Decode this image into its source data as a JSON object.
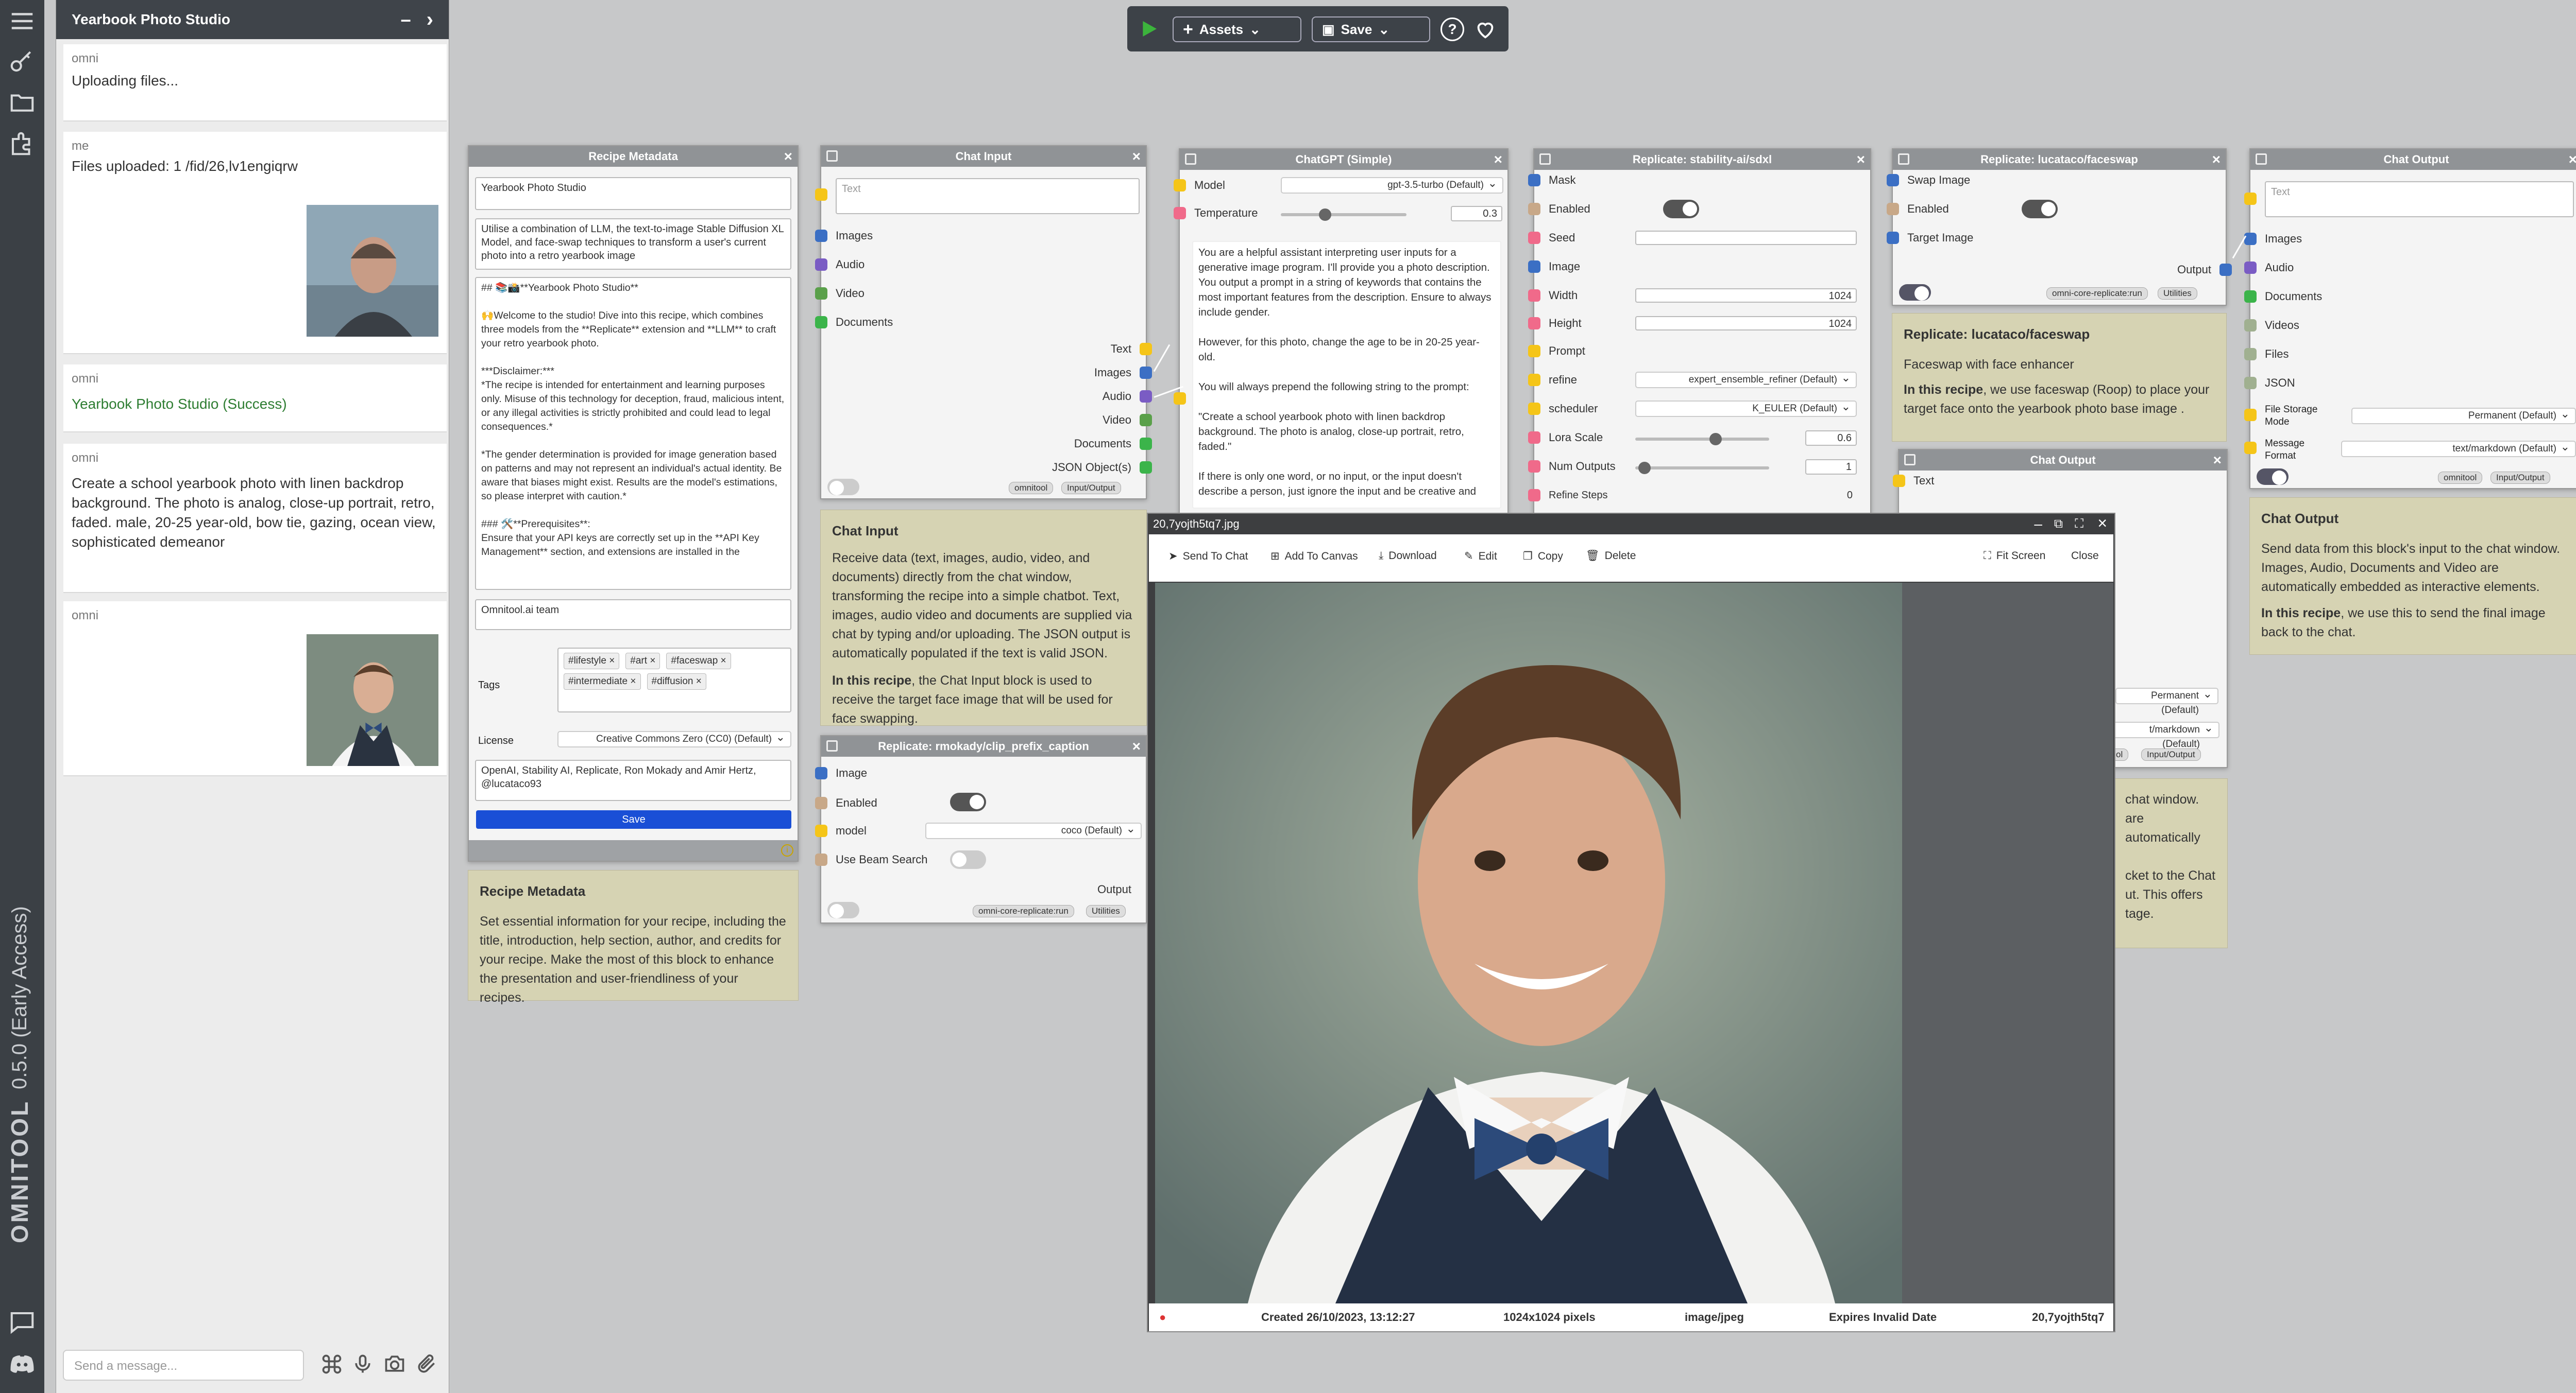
{
  "topbar": {
    "assets_label": "Assets",
    "save_label": "Save"
  },
  "chat": {
    "title": "Yearbook Photo Studio",
    "input_placeholder": "Send a message...",
    "messages": [
      {
        "sender": "omni",
        "text": "Uploading files..."
      },
      {
        "sender": "me",
        "text": "Files uploaded: 1 /fid/26,lv1engiqrw"
      },
      {
        "sender": "omni",
        "text": "Yearbook Photo Studio  (Success)"
      },
      {
        "sender": "omni",
        "text": "Create a school yearbook photo with linen backdrop background. The photo is analog, close-up portrait, retro, faded. male, 20-25 year-old, bow tie, gazing, ocean view, sophisticated demeanor"
      },
      {
        "sender": "omni",
        "text": ""
      }
    ]
  },
  "brand": {
    "name": "OMNITOOL",
    "version": "0.5.0 (Early Access)"
  },
  "recipe": {
    "title": "Recipe Metadata",
    "name": "Yearbook Photo Studio",
    "intro": "Utilise a combination of LLM, the text-to-image Stable Diffusion XL Model, and face-swap techniques to transform a user's current photo into a retro yearbook image",
    "help": "## 📚📸**Yearbook Photo Studio**\n\n🙌Welcome to the studio! Dive into this recipe, which combines three models from the **Replicate** extension and **LLM** to craft your retro yearbook photo.\n\n***Disclaimer:***\n*The recipe is intended for entertainment and learning purposes only. Misuse of this technology for deception, fraud, malicious intent, or any illegal activities is strictly prohibited and could lead to legal consequences.*\n\n*The gender determination is provided for image generation based on patterns and may not represent an individual's actual identity. Be aware that biases might exist. Results are the model's estimations, so please interpret with caution.*\n\n### 🛠️**Prerequisites**:\nEnsure that your API keys are correctly set up in the **API Key Management** section, and extensions are installed in the",
    "author": "Omnitool.ai team",
    "tags_label": "Tags",
    "tags": [
      "#lifestyle",
      "#art",
      "#faceswap",
      "#intermediate",
      "#diffusion"
    ],
    "license_label": "License",
    "license": "Creative Commons Zero (CC0) (Default)",
    "credits": "OpenAI, Stability AI, Replicate, Ron Mokady and Amir Hertz, @lucataco93",
    "save": "Save"
  },
  "recipe_note": {
    "title": "Recipe Metadata",
    "text": "Set essential information for your recipe, including the title, introduction, help section, author, and credits for your recipe. Make the most of this block to enhance the presentation and user-friendliness of your recipes."
  },
  "chat_input": {
    "title": "Chat Input",
    "placeholder": "Text",
    "inputs": [
      "Images",
      "Audio",
      "Video",
      "Documents"
    ],
    "outputs": [
      "Text",
      "Images",
      "Audio",
      "Video",
      "Documents",
      "JSON Object(s)"
    ],
    "badges": [
      "omnitool",
      "Input/Output"
    ]
  },
  "chat_input_note": {
    "title": "Chat Input",
    "text": "Receive data (text, images, audio, video, and documents) directly from the chat window, transforming the recipe into a simple chatbot. Text, images, audio video and documents are supplied via chat by typing and/or uploading. The JSON output is automatically populated if the text is valid JSON.",
    "bold": "In this recipe",
    "text2": ", the Chat Input block is used to receive the target face image that will be used for face swapping."
  },
  "clip": {
    "title": "Replicate: rmokady/clip_prefix_caption",
    "image": "Image",
    "enabled": "Enabled",
    "model": "model",
    "model_value": "coco (Default)",
    "beam": "Use Beam Search",
    "output": "Output",
    "badges": [
      "omni-core-replicate:run",
      "Utilities"
    ]
  },
  "gpt": {
    "title": "ChatGPT (Simple)",
    "model_label": "Model",
    "model_value": "gpt-3.5-turbo (Default)",
    "temp_label": "Temperature",
    "temp_value": "0.3",
    "prompt": "You are a helpful assistant interpreting user inputs for a generative image program. I'll provide you a photo description. You output a prompt in a string of keywords that contains the most important features from the description. Ensure to always include gender.\n\nHowever, for this photo, change the age to be in 20-25 year-old.\n\nYou will always prepend the following string to the prompt:\n\n\"Create a school yearbook photo with linen backdrop background. The photo is analog, close-up portrait, retro, faded.\"\n\nIf there is only one word, or no input, or the input doesn't describe a person, just ignore the input and be creative and"
  },
  "sdxl": {
    "title": "Replicate: stability-ai/sdxl",
    "mask": "Mask",
    "enabled": "Enabled",
    "seed": "Seed",
    "image": "Image",
    "width": "Width",
    "width_value": "1024",
    "height": "Height",
    "height_value": "1024",
    "prompt": "Prompt",
    "refine": "refine",
    "refine_value": "expert_ensemble_refiner (Default)",
    "scheduler": "scheduler",
    "scheduler_value": "K_EULER (Default)",
    "lora": "Lora Scale",
    "lora_value": "0.6",
    "num": "Num Outputs",
    "num_value": "1",
    "refine_steps": "Refine Steps",
    "refine_steps_value": "0"
  },
  "faceswap": {
    "title": "Replicate: lucataco/faceswap",
    "swap": "Swap Image",
    "enabled": "Enabled",
    "target": "Target Image",
    "output": "Output",
    "badges": [
      "omni-core-replicate:run",
      "Utilities"
    ]
  },
  "faceswap_note": {
    "title": "Replicate: lucataco/faceswap",
    "text": "Faceswap with face enhancer",
    "bold": "In this recipe",
    "text2": ", we use faceswap (Roop) to place your target face onto the yearbook photo base image ."
  },
  "chat_output2": {
    "title": "Chat Output",
    "text": "Text",
    "storage": "Permanent (Default)",
    "format": "t/markdown (Default)",
    "badges": [
      "ol",
      "Input/Output"
    ]
  },
  "note_partial": {
    "text": "chat window.\nare automatically\n\ncket to the Chat\nut. This offers\ntage."
  },
  "chat_output": {
    "title": "Chat Output",
    "placeholder": "Text",
    "inputs": [
      "Images",
      "Audio",
      "Documents",
      "Videos",
      "Files",
      "JSON"
    ],
    "storage_label": "File Storage Mode",
    "storage": "Permanent (Default)",
    "format_label": "Message Format",
    "format": "text/markdown (Default)",
    "badges": [
      "omnitool",
      "Input/Output"
    ]
  },
  "chat_output_note": {
    "title": "Chat Output",
    "text": "Send data from this block's input to the chat window. Images, Audio, Documents and Video are automatically embedded as interactive elements.",
    "bold": "In this recipe",
    "text2": ", we use this to send the final image back to the chat."
  },
  "viewer": {
    "filename": "20,7yojth5tq7.jpg",
    "toolbar": [
      "Send To Chat",
      "Add To Canvas",
      "Download",
      "Edit",
      "Copy",
      "Delete"
    ],
    "fit": "Fit Screen",
    "close": "Close",
    "created": "Created 26/10/2023, 13:12:27",
    "size": "1024x1024 pixels",
    "mime": "image/jpeg",
    "expires": "Expires Invalid Date",
    "file": "20,7yojth5tq7"
  },
  "colors": {
    "accent": "#1a4fd6",
    "success": "#2e7d32",
    "text_socket": "#f5c518",
    "image_socket": "#3b6fc4",
    "audio_socket": "#7a5cc4",
    "video_socket": "#5aa04a",
    "docs_socket": "#3bb44a",
    "number_socket": "#f06a8a"
  }
}
